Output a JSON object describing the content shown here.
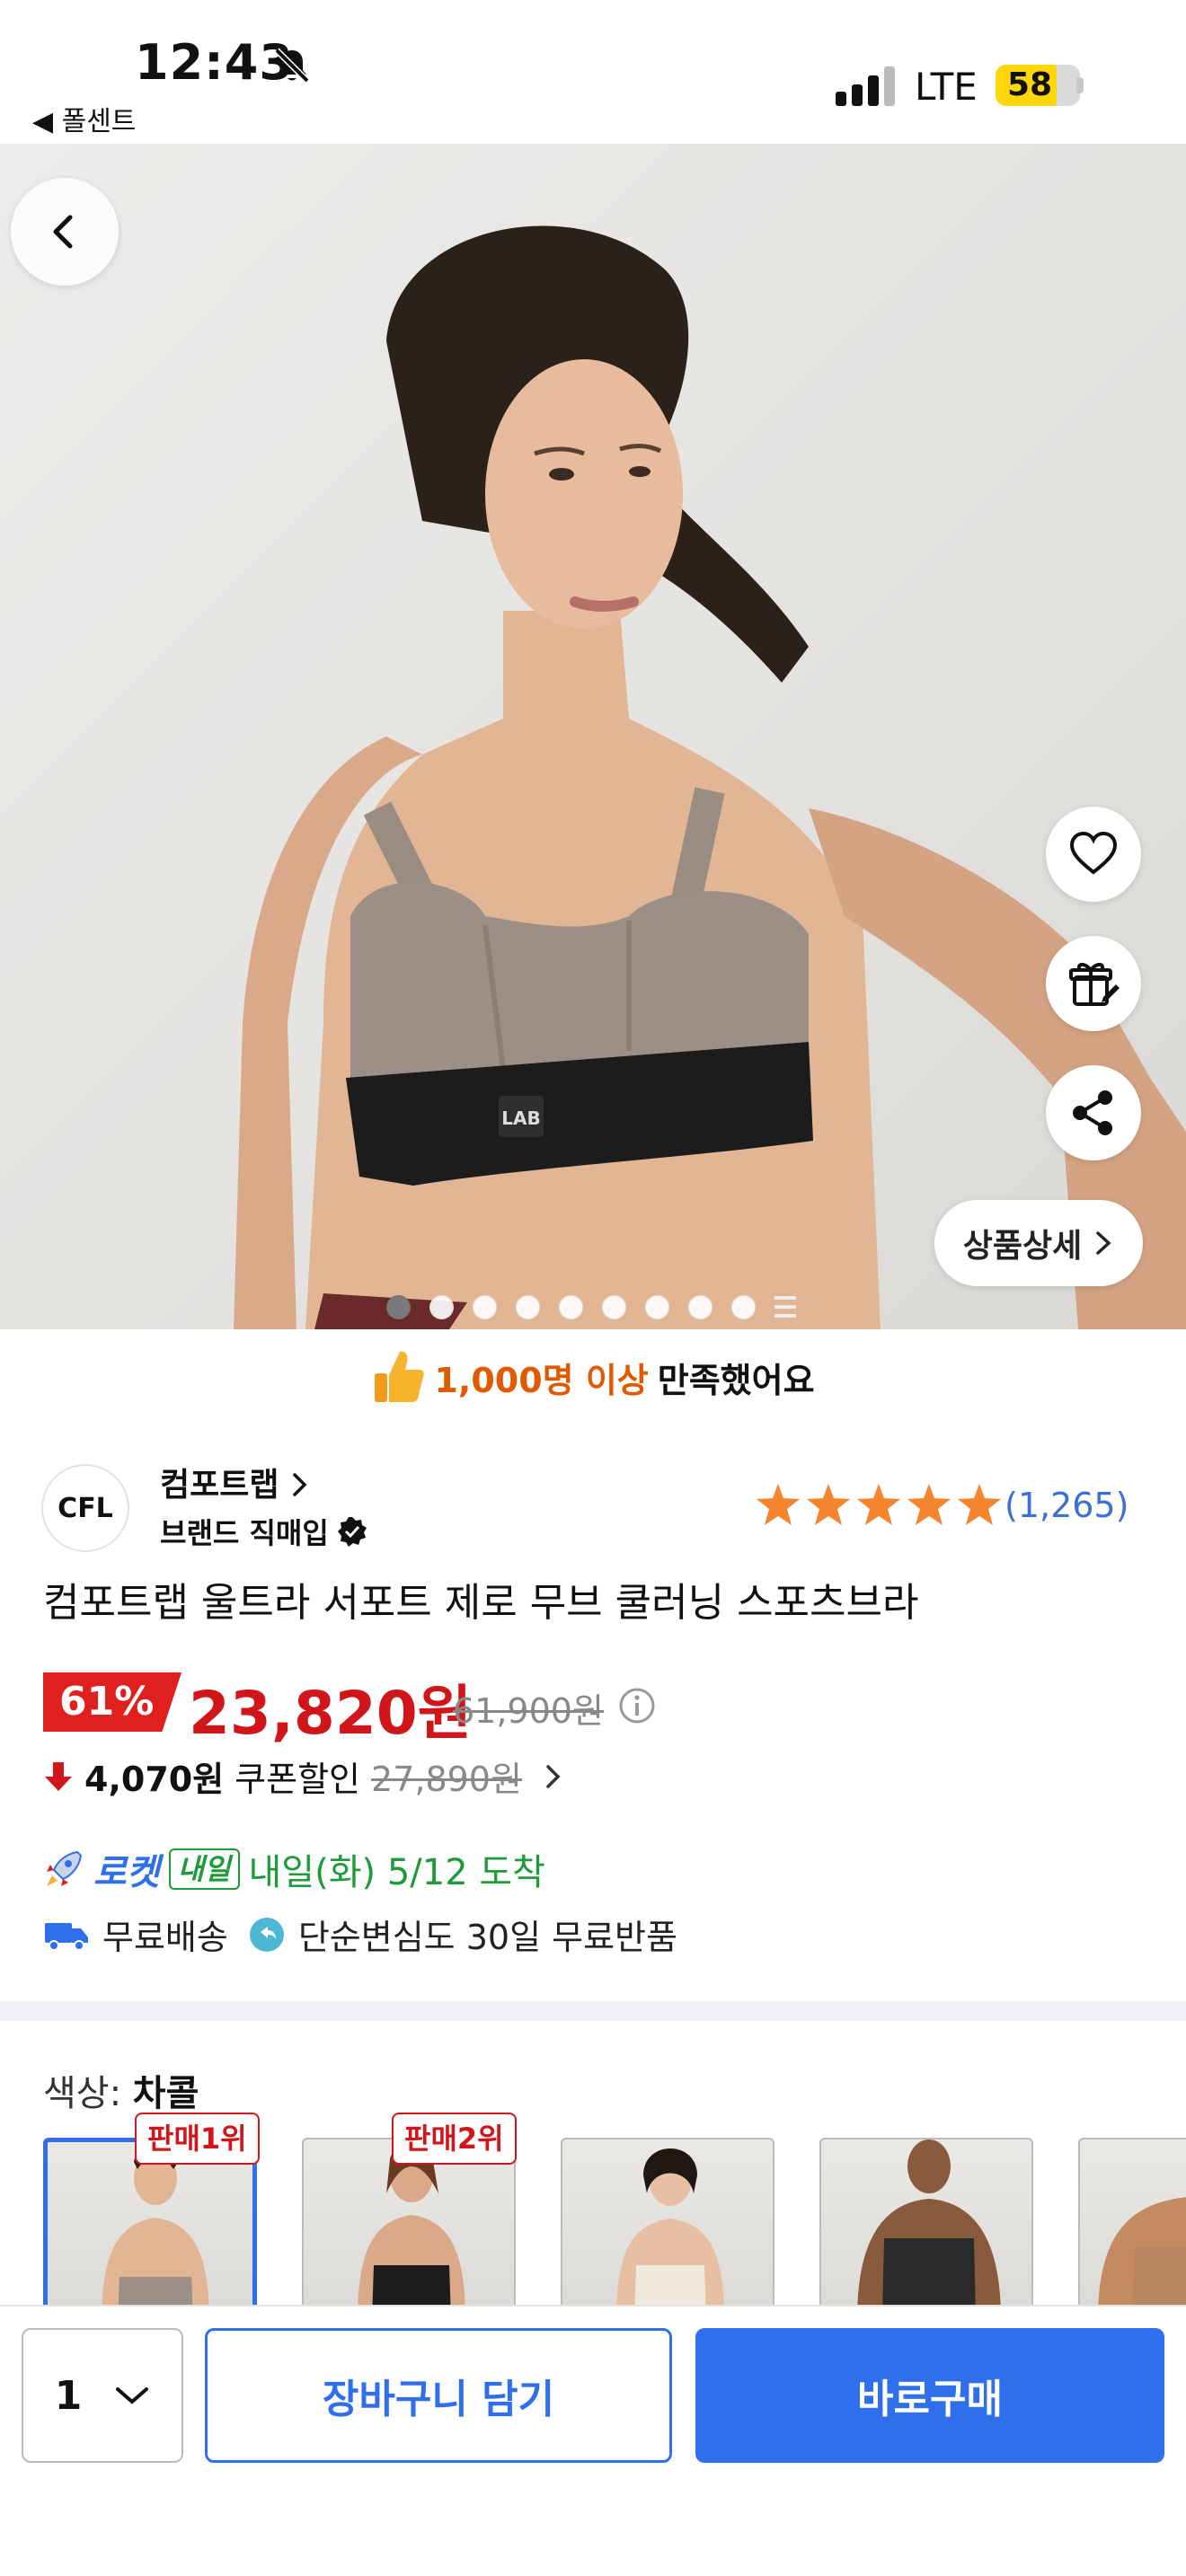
{
  "status_bar": {
    "time": "12:43",
    "back_app": "◀ 폴센트",
    "network": "LTE",
    "battery": "58"
  },
  "hero": {
    "detail_button": "상품상세",
    "image_count": 10,
    "active_image_index": 0
  },
  "satisfaction": {
    "highlight": "1,000명 이상",
    "text": "만족했어요"
  },
  "brand": {
    "logo_text": "CFL",
    "name": "컴포트랩",
    "direct_label": "브랜드 직매입",
    "rating_stars": 5,
    "review_count": "(1,265)"
  },
  "product": {
    "title": "컴포트랩 울트라 서포트 제로 무브 쿨러닝 스포츠브라"
  },
  "price": {
    "discount": "61%",
    "sale_price": "23,820원",
    "original_price": "61,900원",
    "coupon_amount": "4,070원",
    "coupon_label": "쿠폰할인",
    "coupon_original": "27,890원"
  },
  "delivery": {
    "rocket_label": "로켓",
    "naeil_badge": "내일",
    "arrival_text": "내일(화) 5/12 도착",
    "free_shipping": "무료배송",
    "free_return": "단순변심도 30일 무료반품"
  },
  "options": {
    "color_label": "색상:",
    "color_value": "차콜",
    "rank_badges": [
      "판매1위",
      "판매2위"
    ]
  },
  "bottom_bar": {
    "quantity": "1",
    "cart_button": "장바구니 담기",
    "buy_button": "바로구매"
  },
  "colors": {
    "accent_blue": "#2f6fec",
    "price_red": "#d0161b",
    "rocket_green": "#1d9a3a",
    "satisfaction_orange": "#e05a00"
  }
}
